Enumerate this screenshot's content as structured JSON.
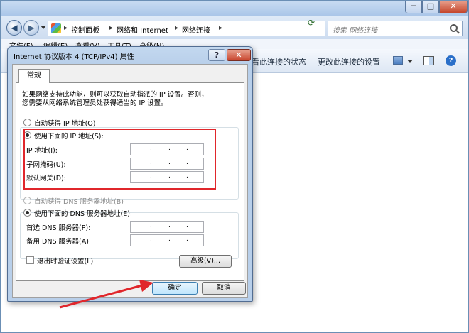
{
  "explorer": {
    "window_controls": {
      "min": "─",
      "max": "□",
      "close": "✕"
    },
    "nav": {
      "back": "◀",
      "forward": "▶"
    },
    "breadcrumb": [
      "控制面板",
      "网络和 Internet",
      "网络连接"
    ],
    "search_placeholder": "搜索 网络连接",
    "menu": [
      "文件(F)",
      "编辑(E)",
      "查看(V)",
      "工具(T)",
      "高级(N)"
    ],
    "commands": {
      "view_status": "查看此连接的状态",
      "change_settings": "更改此连接的设置"
    },
    "icons": [
      "control-panel-icon",
      "refresh-icon",
      "search-icon",
      "view-icon",
      "preview-pane-icon",
      "help-icon"
    ]
  },
  "dialog": {
    "title": "Internet 协议版本 4 (TCP/IPv4) 属性",
    "help_btn": "?",
    "close_btn": "✕",
    "tab": "常规",
    "desc_line1": "如果网络支持此功能，则可以获取自动指派的 IP 设置。否则，",
    "desc_line2": "您需要从网络系统管理员处获得适当的 IP 设置。",
    "ip": {
      "auto_label": "自动获得 IP 地址(O)",
      "manual_label": "使用下面的 IP 地址(S):",
      "selected": "manual",
      "fields": [
        {
          "label": "IP 地址(I):",
          "value": ". . ."
        },
        {
          "label": "子网掩码(U):",
          "value": ". . ."
        },
        {
          "label": "默认网关(D):",
          "value": ". . ."
        }
      ]
    },
    "dns": {
      "auto_label": "自动获得 DNS 服务器地址(B)",
      "manual_label": "使用下面的 DNS 服务器地址(E):",
      "selected": "manual",
      "fields": [
        {
          "label": "首选 DNS 服务器(P):",
          "value": ". . ."
        },
        {
          "label": "备用 DNS 服务器(A):",
          "value": ". . ."
        }
      ]
    },
    "validate_label": "退出时验证设置(L)",
    "validate_checked": false,
    "advanced_btn": "高级(V)...",
    "ok_btn": "确定",
    "cancel_btn": "取消"
  },
  "annotation_color": "#e0262b"
}
